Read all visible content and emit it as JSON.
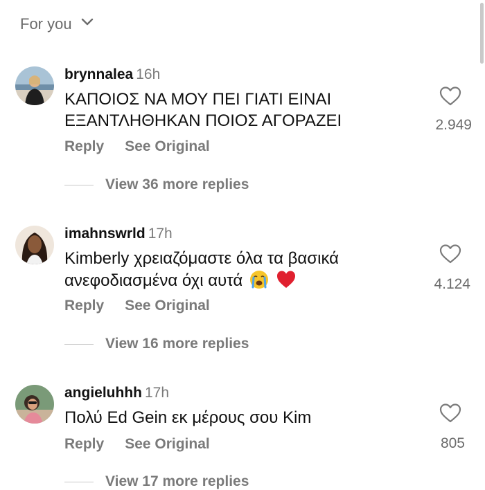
{
  "header": {
    "filter_label": "For you"
  },
  "comments": [
    {
      "username": "brynnalea",
      "time": "16h",
      "text_line1": "ΚΑΠΟΙΟΣ ΝΑ ΜΟΥ ΠΕΙ ΓΙΑΤΙ ΕΙΝΑΙ",
      "text_line2": "ΕΞΑΝΤΛΗΘΗΚΑΝ ΠΟΙΟΣ ΑΓΟΡΑΖΕΙ",
      "likes": "2.949",
      "reply_label": "Reply",
      "see_original_label": "See Original",
      "view_replies": "View 36 more replies"
    },
    {
      "username": "imahnswrld",
      "time": "17h",
      "text_line1": "Kimberly χρειαζόμαστε όλα τα βασικά",
      "text_line2": "ανεφοδιασμένα όχι αυτά",
      "likes": "4.124",
      "reply_label": "Reply",
      "see_original_label": "See Original",
      "view_replies": "View 16 more replies"
    },
    {
      "username": "angieluhhh",
      "time": "17h",
      "text_line1": "Πολύ Ed Gein εκ μέρους σου Kim",
      "likes": "805",
      "reply_label": "Reply",
      "see_original_label": "See Original",
      "view_replies": "View 17 more replies"
    }
  ],
  "icons": {
    "chevron": "chevron-down-icon",
    "heart": "heart-outline-icon",
    "crying_emoji": "loudly-crying-face-emoji",
    "red_heart_emoji": "red-heart-emoji"
  },
  "colors": {
    "text_primary": "#111111",
    "text_secondary": "#7a7a7a",
    "heart_emoji": "#e0202f"
  }
}
